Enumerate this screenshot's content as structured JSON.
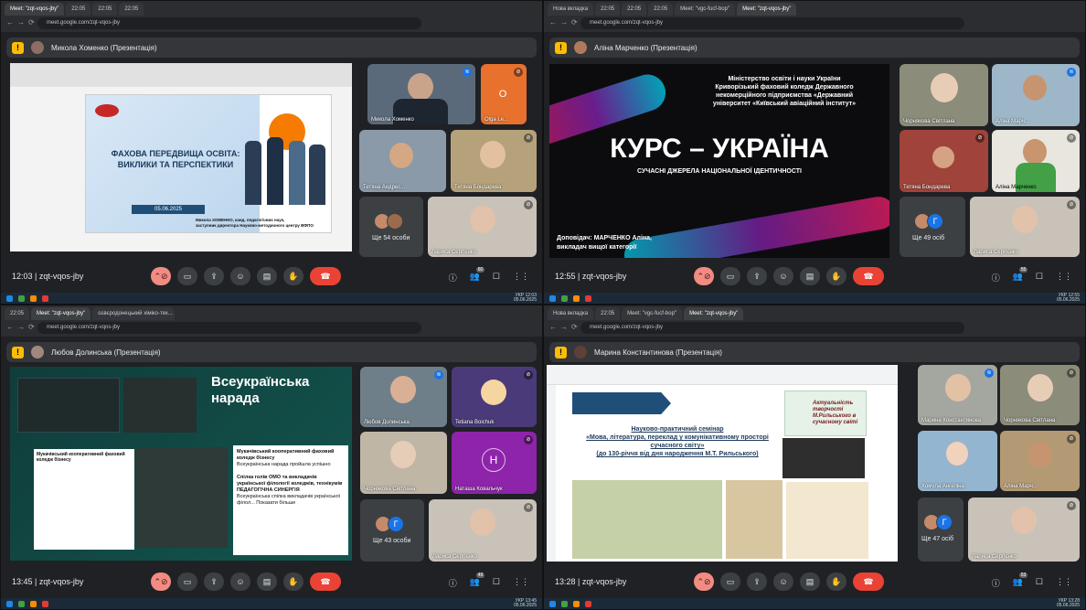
{
  "windows": [
    {
      "tabs": [
        "Meet: \"zqt-vqos-jby\"",
        "22:05",
        "22:05",
        "22:05"
      ],
      "url": "meet.google.com/zqt-vqos-jby",
      "presenter": "Микола Хоменко (Презентація)",
      "time": "12:03",
      "code": "zqt-vqos-jby",
      "people": "60",
      "slide": {
        "title": "ФАХОВА ПЕРЕДВИЩА ОСВІТА:\nВИКЛИКИ ТА ПЕРСПЕКТИКИ",
        "date": "05.06.2025",
        "author": "Микола ХОМЕНКО, канд. педагогічних наук,\nзаступник директора Науково-методичного центру ВФПО"
      },
      "tiles": [
        "Микола Хоменко",
        "Olga Le...",
        "Тетяна Андрес...",
        "Тетяна Бондарева",
        "Лариса Сергієнко"
      ],
      "more": "Ще 54 особи",
      "more_initial": "O",
      "tray": {
        "lang": "УКР",
        "time": "12:03",
        "date": "05.06.2025"
      }
    },
    {
      "tabs": [
        "Нова вкладка",
        "22:05",
        "22:05",
        "22:05",
        "Meet: \"vgc-fucf-bop\"",
        "Meet: \"zqt-vqos-jby\""
      ],
      "url": "meet.google.com/zqt-vqos-jby",
      "presenter": "Аліна Марченко (Презентація)",
      "time": "12:55",
      "code": "zqt-vqos-jby",
      "people": "55",
      "slide": {
        "header": "Міністерство освіти і науки України\nКриворізький фаховий коледж Державного\nнекомерційного підприємства «Державний\nуніверситет «Київський авіаційний інститут»",
        "title": "КУРС – УКРАЇНА",
        "subtitle": "СУЧАСНІ ДЖЕРЕЛА НАЦІОНАЛЬНОЇ ІДЕНТИЧНОСТІ",
        "speaker": "Доповідач: МАРЧЕНКО Аліна,\nвикладач вищої категорії"
      },
      "tiles": [
        "Чорнякова Світлана",
        "Аліна Марч...",
        "Тетяна Бондарева",
        "Аліна Марченко",
        "Лариса Сергієнко"
      ],
      "more": "Ще 49 осіб",
      "more_initial": "Г",
      "tray": {
        "lang": "УКР",
        "time": "12:55",
        "date": "05.06.2025"
      }
    },
    {
      "tabs": [
        "22:05",
        "Meet: \"zqt-vqos-jby\"",
        "сєвєродонецький хіміко-тех..."
      ],
      "url": "meet.google.com/zqt-vqos-jby",
      "presenter": "Любов Долинська (Презентація)",
      "time": "13:45",
      "code": "zqt-vqos-jby",
      "people": "49",
      "slide": {
        "title": "Всеукраїнська\nнарада",
        "post1": "Мукачівський кооперативний фаховий коледж бізнесу",
        "post1b": "Всеукраїнська нарада пройшла успішно",
        "post2": "Спілка голів ОМО та викладачів української філології коледжів, технікумів",
        "post2b": "ПЕДАГОГІЧНА СИНЕРГІЯ",
        "post2c": "Всеукраїнська спілка викладачів української філол... Показати більше"
      },
      "tiles": [
        "Любов Долинська",
        "Tetiana Boichuk",
        "Чорнякова Світлана",
        "Наташа Ковальчук",
        "Лариса Сергієнко"
      ],
      "more": "Ще 43 особи",
      "more_initial": "Г",
      "tray": {
        "lang": "УКР",
        "time": "13:45",
        "date": "05.06.2025"
      }
    },
    {
      "tabs": [
        "Нова вкладка",
        "22:05",
        "Meet: \"vgc-fucf-bop\"",
        "Meet: \"zqt-vqos-jby\""
      ],
      "url": "meet.google.com/zqt-vqos-jby",
      "presenter": "Марина Константинова (Презентація)",
      "time": "13:28",
      "code": "zqt-vqos-jby",
      "people": "53",
      "slide": {
        "title": "Науково-практичний семінар\n«Мова, література, переклад у комунікативному просторі сучасного світу»\n(до 130-річчя від дня народження М.Т. Рильського)",
        "card": "Актуальність творчості М.Рильського в сучасному світі"
      },
      "tiles": [
        "Марина Константинова",
        "Чорнякова Світлана",
        "Хомула Ангеліна",
        "Аліна Марч...",
        "Лариса Сергієнко"
      ],
      "more": "Ще 47 осіб",
      "more_initial": "Г",
      "tray": {
        "lang": "УКР",
        "time": "13:28",
        "date": "05.06.2025"
      }
    }
  ]
}
